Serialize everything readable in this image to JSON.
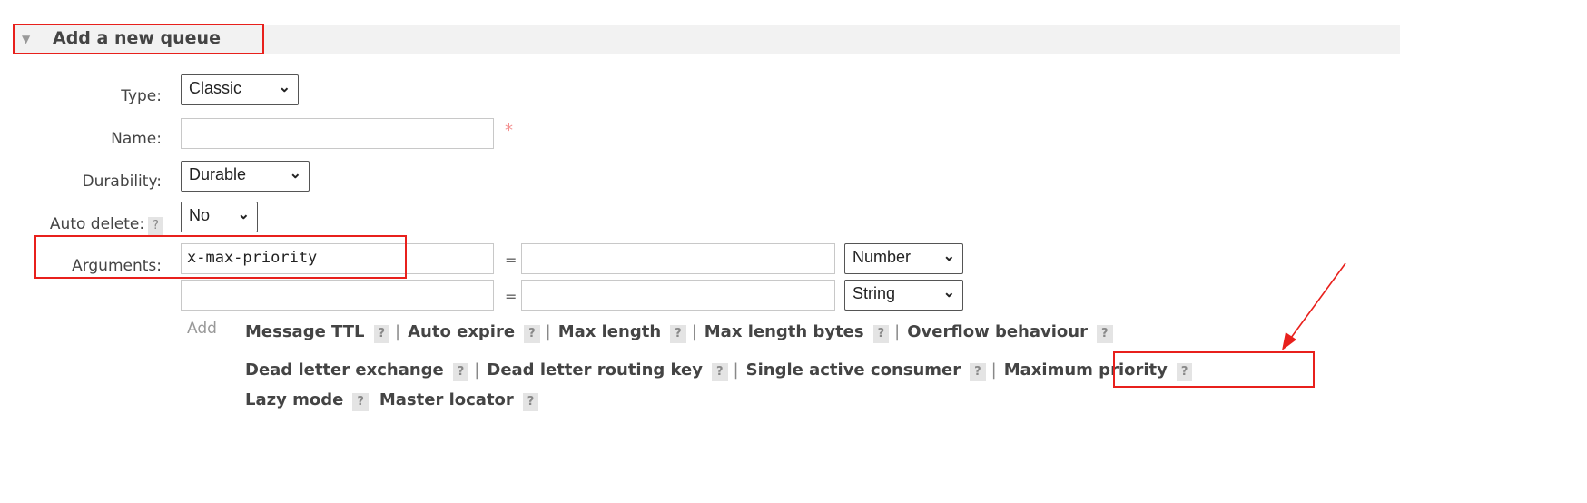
{
  "section": {
    "title": "Add a new queue",
    "toggle_icon": "triangle-down-icon"
  },
  "form": {
    "type": {
      "label": "Type:",
      "value": "Classic"
    },
    "name": {
      "label": "Name:",
      "value": "",
      "required_mark": "*"
    },
    "durability": {
      "label": "Durability:",
      "value": "Durable"
    },
    "auto_delete": {
      "label": "Auto delete:",
      "help": "?",
      "value": "No"
    },
    "arguments": {
      "label": "Arguments:",
      "rows": [
        {
          "key": "x-max-priority",
          "eq": "=",
          "value": "",
          "type": "Number"
        },
        {
          "key": "",
          "eq": "=",
          "value": "",
          "type": "String"
        }
      ]
    }
  },
  "add_label": "Add",
  "arg_links": [
    [
      {
        "label": "Message TTL",
        "help": "?"
      },
      {
        "label": "Auto expire",
        "help": "?"
      },
      {
        "label": "Max length",
        "help": "?"
      },
      {
        "label": "Max length bytes",
        "help": "?"
      },
      {
        "label": "Overflow behaviour",
        "help": "?"
      }
    ],
    [
      {
        "label": "Dead letter exchange",
        "help": "?"
      },
      {
        "label": "Dead letter routing key",
        "help": "?"
      },
      {
        "label": "Single active consumer",
        "help": "?"
      },
      {
        "label": "Maximum priority",
        "help": "?"
      }
    ],
    [
      {
        "label": "Lazy mode",
        "help": "?"
      },
      {
        "label": "Master locator",
        "help": "?"
      }
    ]
  ],
  "separator": "|",
  "annotation_color": "#e8201c"
}
